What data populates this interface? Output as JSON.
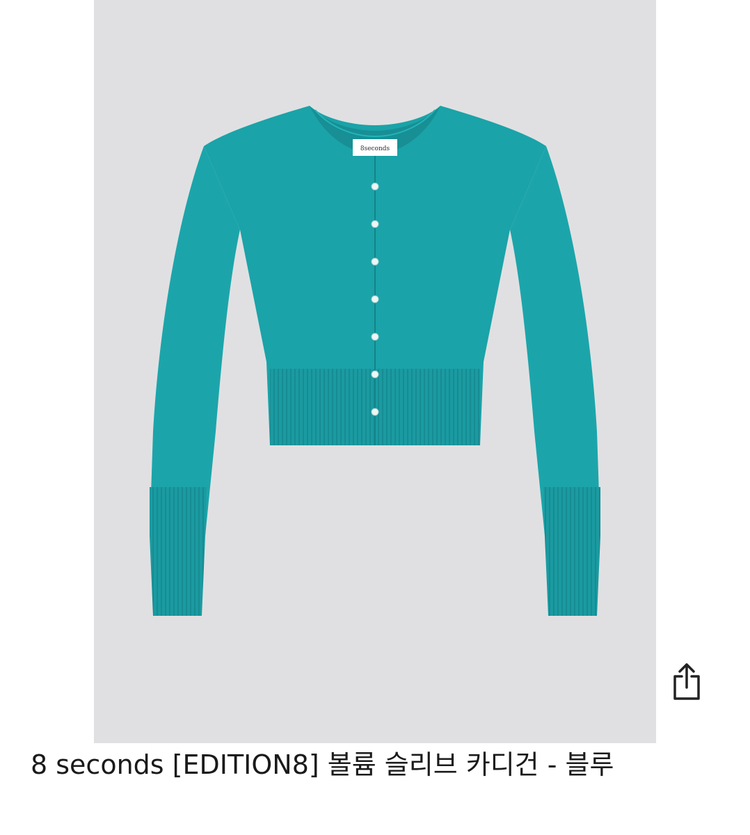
{
  "product": {
    "image_label": "8seconds",
    "garment_color": "#1aa3a8",
    "background_color": "#e0e0e2",
    "title": "8 seconds [EDITION8] 볼륨 슬리브 카디건 - 블루"
  },
  "actions": {
    "share_icon": "share-icon"
  }
}
